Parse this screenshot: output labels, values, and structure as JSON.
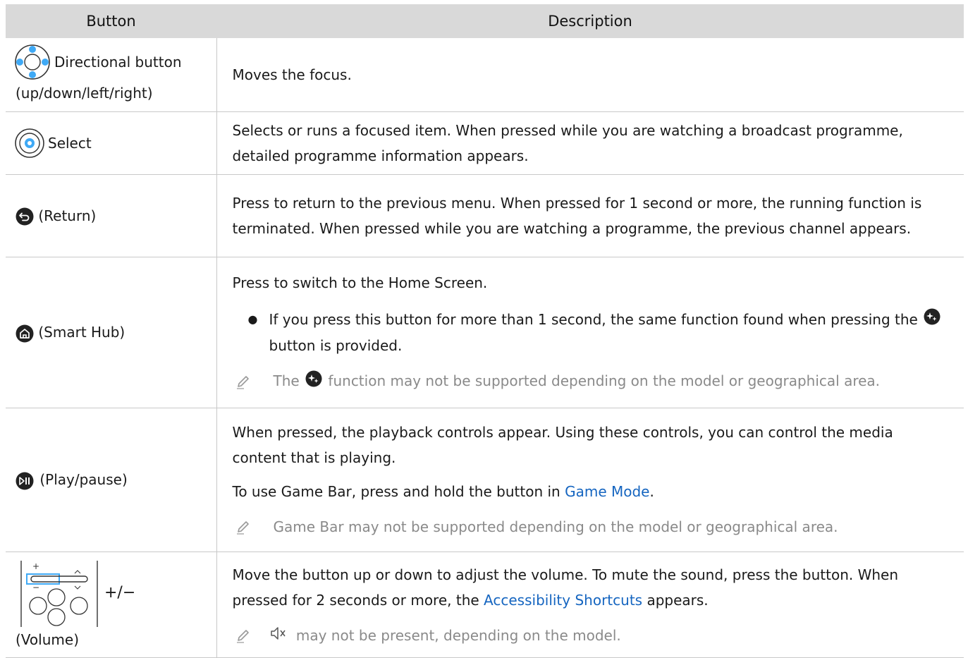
{
  "table": {
    "header_button": "Button",
    "header_description": "Description"
  },
  "rows": {
    "directional": {
      "label_line1": "Directional button",
      "label_line2": "(up/down/left/right)",
      "description": "Moves the focus."
    },
    "select": {
      "label": "Select",
      "description": "Selects or runs a focused item. When pressed while you are watching a broadcast programme, detailed programme information appears."
    },
    "return": {
      "label": "(Return)",
      "description": "Press to return to the previous menu. When pressed for 1 second or more, the running function is terminated. When pressed while you are watching a programme, the previous channel appears."
    },
    "smarthub": {
      "label": "(Smart Hub)",
      "description": "Press to switch to the Home Screen.",
      "bullet_before": "If you press this button for more than 1 second, the same function found when pressing the",
      "bullet_after": "button is provided.",
      "note_before": "The",
      "note_after": "function may not be supported depending on the model or geographical area."
    },
    "playpause": {
      "label": "(Play/pause)",
      "description1": "When pressed, the playback controls appear. Using these controls, you can control the media content that is playing.",
      "description2_before": "To use Game Bar, press and hold the button in",
      "description2_link": "Game Mode",
      "description2_after": ".",
      "note": "Game Bar may not be supported depending on the model or geographical area."
    },
    "volume": {
      "label": "(Volume)",
      "symbol": "+/−",
      "description_before": "Move the button up or down to adjust the volume. To mute the sound, press the button. When pressed for 2 seconds or more, the",
      "description_link": "Accessibility Shortcuts",
      "description_after": "appears.",
      "note_after": "may not be present, depending on the model."
    }
  },
  "icons": {
    "directional": "directional-pad-icon",
    "select": "select-icon",
    "return": "return-icon",
    "smarthub": "home-icon",
    "ai": "ai-function-icon",
    "playpause": "play-pause-icon",
    "volume": "volume-rocker-icon",
    "mute": "mute-icon",
    "note": "pencil-note-icon"
  },
  "colors": {
    "header_bg": "#d9d9d9",
    "link": "#1565c0",
    "note_text": "#8a8a8a",
    "icon_blue": "#3fa9f5"
  }
}
